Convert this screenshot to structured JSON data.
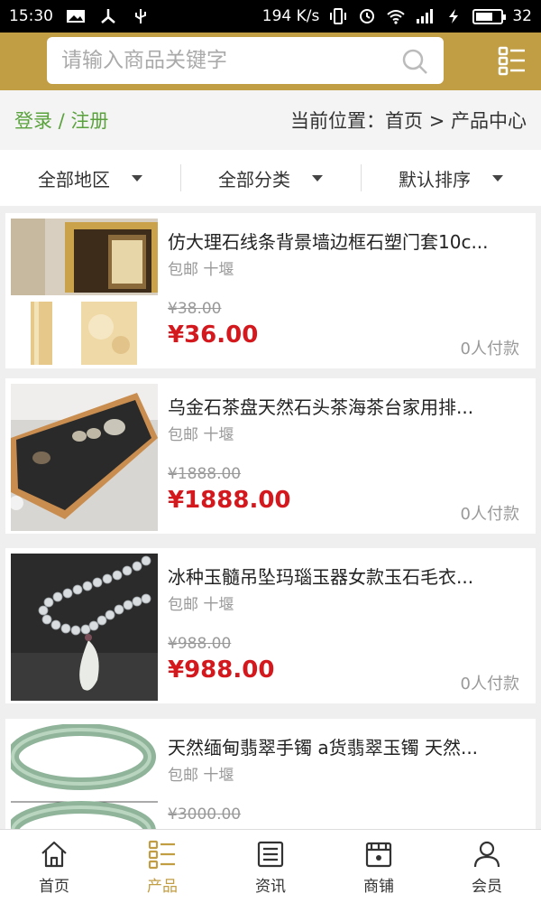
{
  "status_bar": {
    "time": "15:30",
    "network_speed": "194 K/s",
    "battery_level": "32"
  },
  "header": {
    "search_placeholder": "请输入商品关键字"
  },
  "crumbbar": {
    "login_text": "登录 / 注册",
    "location_text": "当前位置：首页 > 产品中心"
  },
  "filters": [
    {
      "label": "全部地区"
    },
    {
      "label": "全部分类"
    },
    {
      "label": "默认排序"
    }
  ],
  "products": [
    {
      "title": "仿大理石线条背景墙边框石塑门套10c...",
      "meta": "包邮 十堰",
      "old_price": "¥38.00",
      "price": "¥36.00",
      "sold": "0人付款"
    },
    {
      "title": "乌金石茶盘天然石头茶海茶台家用排...",
      "meta": "包邮 十堰",
      "old_price": "¥1888.00",
      "price": "¥1888.00",
      "sold": "0人付款"
    },
    {
      "title": "冰种玉髓吊坠玛瑙玉器女款玉石毛衣...",
      "meta": "包邮 十堰",
      "old_price": "¥988.00",
      "price": "¥988.00",
      "sold": "0人付款"
    },
    {
      "title": "天然缅甸翡翠手镯 a货翡翠玉镯 天然...",
      "meta": "包邮 十堰",
      "old_price": "¥3000.00",
      "price": "",
      "sold": ""
    }
  ],
  "bottom_nav": [
    {
      "label": "首页",
      "icon": "home-icon"
    },
    {
      "label": "产品",
      "icon": "grid-list-icon"
    },
    {
      "label": "资讯",
      "icon": "news-icon"
    },
    {
      "label": "商铺",
      "icon": "shop-icon"
    },
    {
      "label": "会员",
      "icon": "user-icon"
    }
  ],
  "colors": {
    "brand": "#c19e44",
    "price": "#d3191e",
    "login": "#5aa23c"
  }
}
